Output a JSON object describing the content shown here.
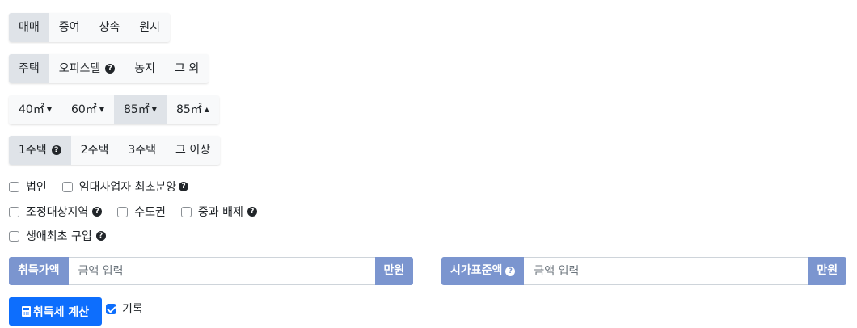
{
  "trade_type": {
    "options": [
      "매매",
      "증여",
      "상속",
      "원시"
    ],
    "selected": "매매"
  },
  "property_type": {
    "options": [
      "주택",
      "오피스텔",
      "농지",
      "그 외"
    ],
    "help_on": "오피스텔",
    "selected": "주택"
  },
  "area": {
    "options": [
      "40㎡",
      "60㎡",
      "85㎡",
      "85㎡"
    ],
    "markers": [
      "▼",
      "▼",
      "▼",
      "▲"
    ],
    "selected_index": 2
  },
  "house_count": {
    "options": [
      "1주택",
      "2주택",
      "3주택",
      "그 이상"
    ],
    "help_on": "1주택",
    "selected": "1주택"
  },
  "checks": {
    "corporation": "법인",
    "rental_first_sale": "임대사업자 최초분양",
    "regulated_area": "조정대상지역",
    "capital_area": "수도권",
    "heavy_tax_exclusion": "중과 배제",
    "first_purchase": "생애최초 구입"
  },
  "acquisition_price": {
    "label": "취득가액",
    "placeholder": "금액 입력",
    "unit": "만원"
  },
  "standard_price": {
    "label": "시가표준액",
    "placeholder": "금액 입력",
    "unit": "만원"
  },
  "calc_button": "취득세 계산",
  "record": {
    "label": "기록",
    "checked": true
  },
  "colors": {
    "primary": "#0d6efd",
    "addon": "#7b95cf",
    "active_segment": "#dfe3e8"
  }
}
